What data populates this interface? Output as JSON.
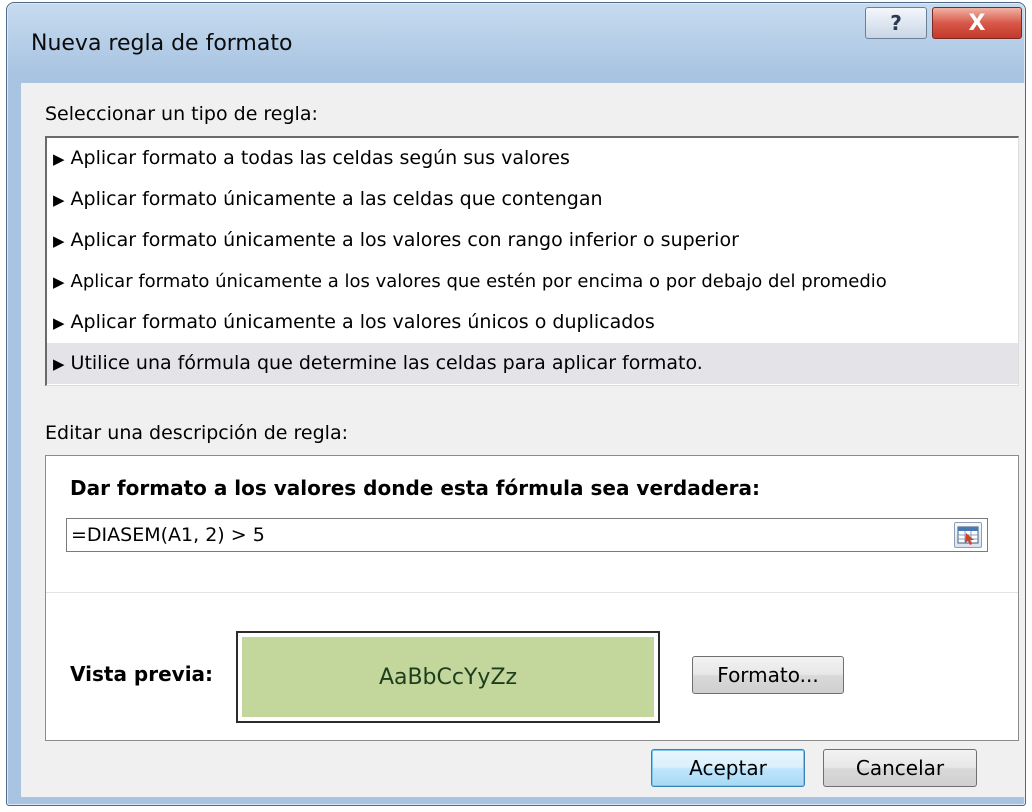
{
  "window": {
    "title": "Nueva regla de formato",
    "help_label": "?",
    "close_label": "X"
  },
  "rule_type": {
    "label": "Seleccionar un tipo de regla:",
    "items": [
      {
        "label": "Aplicar formato a todas las celdas según sus valores",
        "selected": false
      },
      {
        "label": "Aplicar formato únicamente a las celdas que contengan",
        "selected": false
      },
      {
        "label": "Aplicar formato únicamente a los valores con rango inferior o superior",
        "selected": false
      },
      {
        "label": "Aplicar formato únicamente a los valores que estén por encima o por debajo del promedio",
        "selected": false
      },
      {
        "label": "Aplicar formato únicamente a los valores únicos o duplicados",
        "selected": false
      },
      {
        "label": "Utilice una fórmula que determine las celdas para aplicar formato.",
        "selected": true
      }
    ],
    "arrow_glyph": "▶"
  },
  "description": {
    "label": "Editar una descripción de regla:",
    "heading": "Dar formato a los valores donde esta fórmula sea verdadera:",
    "formula_value": "=DIASEM(A1, 2) > 5",
    "preview_label": "Vista previa:",
    "preview_text": "AaBbCcYyZz",
    "preview_fill": "#c3d69b",
    "format_button": "Formato..."
  },
  "footer": {
    "ok_label": "Aceptar",
    "cancel_label": "Cancelar"
  }
}
